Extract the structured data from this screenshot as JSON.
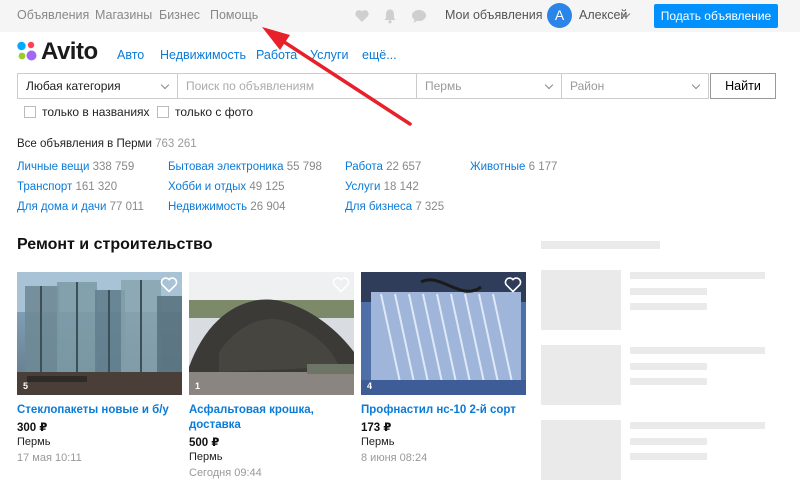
{
  "topbar": {
    "links": [
      "Объявления",
      "Магазины",
      "Бизнес",
      "Помощь"
    ],
    "my_ads": "Мои объявления",
    "avatar_letter": "А",
    "username": "Алексей",
    "post_button": "Подать объявление"
  },
  "logo_text": "Avito",
  "nav": [
    "Авто",
    "Недвижимость",
    "Работа",
    "Услуги",
    "ещё..."
  ],
  "search": {
    "category": "Любая категория",
    "query_placeholder": "Поиск по объявлениям",
    "city": "Пермь",
    "district": "Район",
    "find_button": "Найти",
    "only_titles": "только в названиях",
    "only_photo": "только с фото"
  },
  "all_ads": {
    "label": "Все объявления в Перми",
    "count": "763 261"
  },
  "categories": [
    {
      "name": "Личные вещи",
      "count": "338 759"
    },
    {
      "name": "Транспорт",
      "count": "161 320"
    },
    {
      "name": "Для дома и дачи",
      "count": "77 011"
    },
    {
      "name": "Бытовая электроника",
      "count": "55 798"
    },
    {
      "name": "Хобби и отдых",
      "count": "49 125"
    },
    {
      "name": "Недвижимость",
      "count": "26 904"
    },
    {
      "name": "Работа",
      "count": "22 657"
    },
    {
      "name": "Услуги",
      "count": "18 142"
    },
    {
      "name": "Для бизнеса",
      "count": "7 325"
    },
    {
      "name": "Животные",
      "count": "6 177"
    }
  ],
  "section_title": "Ремонт и строительство",
  "listings": [
    {
      "title": "Стеклопакеты новые и б/у",
      "price": "300 ₽",
      "city": "Пермь",
      "date": "17 мая 10:11",
      "photos": "5"
    },
    {
      "title": "Асфальтовая крошка, доставка",
      "price": "500 ₽",
      "city": "Пермь",
      "date": "Сегодня 09:44",
      "photos": "1"
    },
    {
      "title": "Профнастил нс-10 2-й сорт",
      "price": "173 ₽",
      "city": "Пермь",
      "date": "8 июня 08:24",
      "photos": "4"
    }
  ],
  "colors": {
    "accent": "#0091ff",
    "link": "#0a7bd8",
    "annotation_arrow": "#e8202a"
  }
}
